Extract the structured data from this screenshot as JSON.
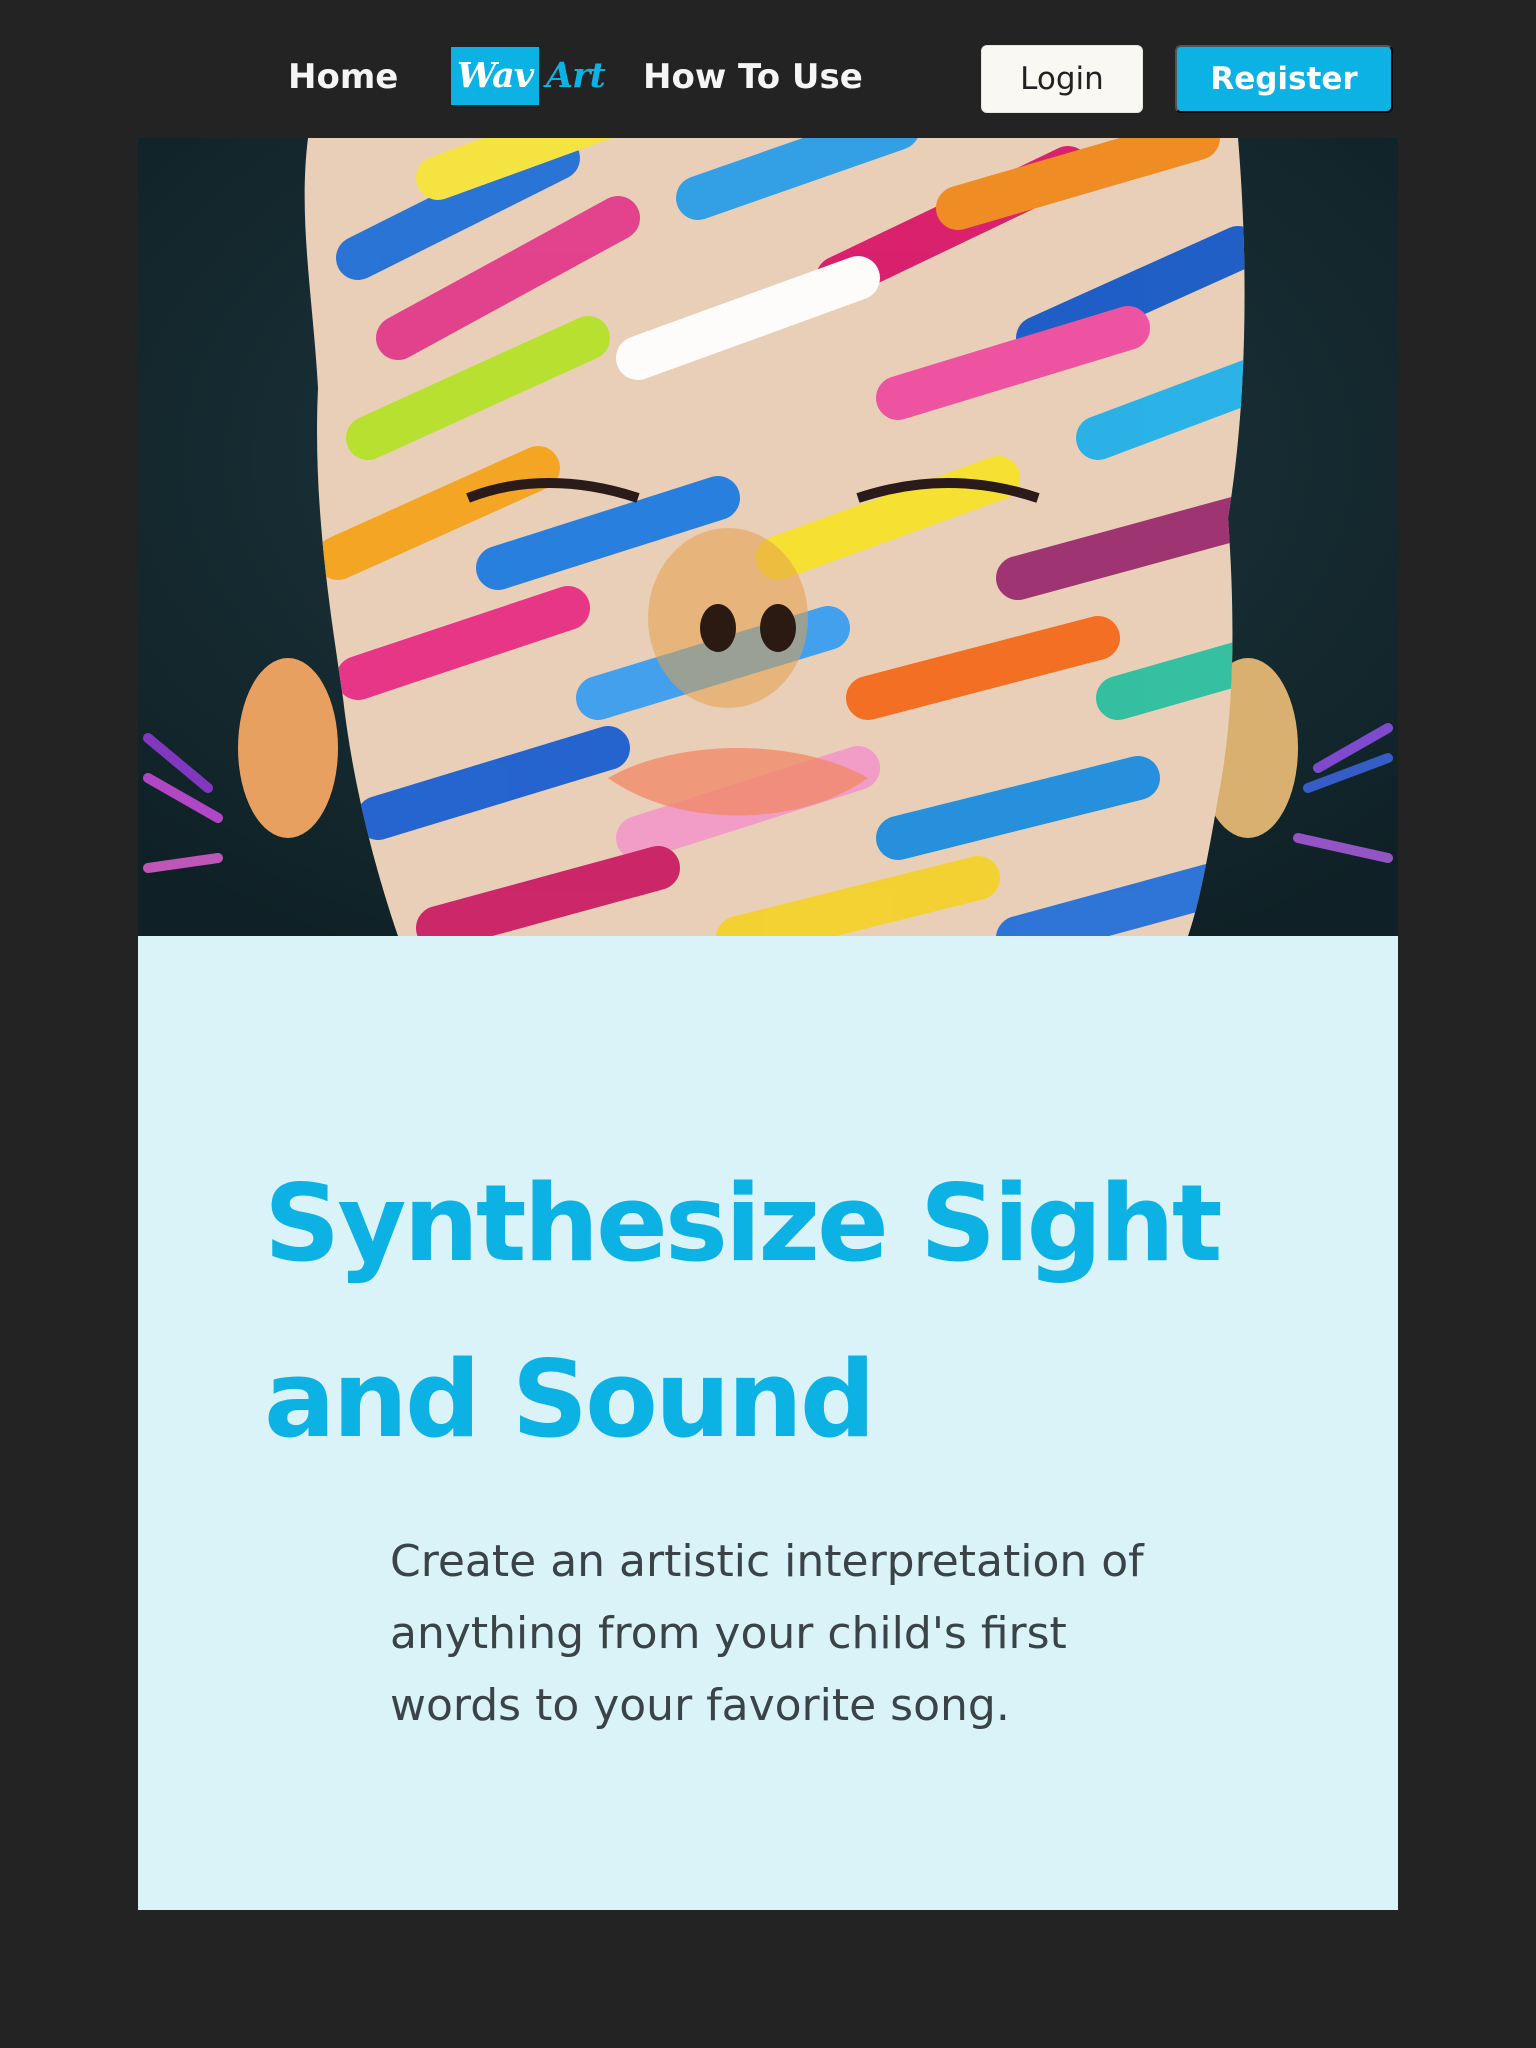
{
  "nav": {
    "home_label": "Home",
    "howto_label": "How To Use",
    "logo_part1": "Wav",
    "logo_part2": "Art",
    "login_label": "Login",
    "register_label": "Register"
  },
  "hero": {
    "image_alt": "Close-up of a face covered in colorful brush-stroke paint"
  },
  "main": {
    "headline": "Synthesize Sight and Sound",
    "subtext": "Create an artistic interpretation of anything from your child's first words to your favorite song."
  },
  "colors": {
    "accent": "#0db2e4",
    "background": "#232323",
    "panel": "#daf3f8",
    "text": "#3a4448"
  }
}
